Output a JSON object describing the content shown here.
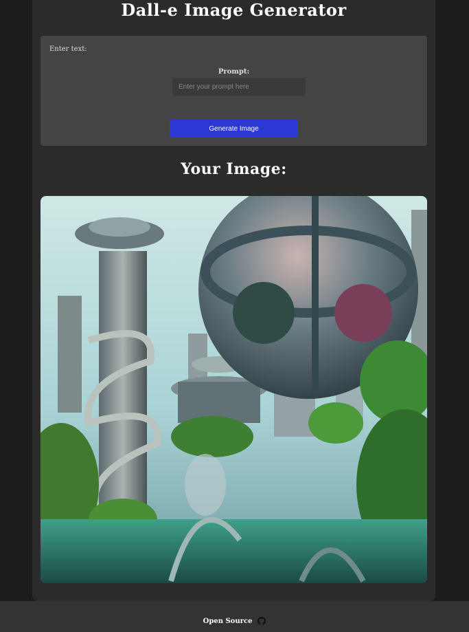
{
  "header": {
    "title": "Dall-e Image Generator"
  },
  "form": {
    "section_label": "Enter text:",
    "prompt_label": "Prompt:",
    "prompt_placeholder": "Enter your prompt here",
    "prompt_value": "",
    "generate_label": "Generate Image"
  },
  "result": {
    "title": "Your Image:"
  },
  "footer": {
    "link_label": "Open Source",
    "icon": "github-icon"
  },
  "colors": {
    "accent": "#2b38d4",
    "panel": "#444444",
    "card": "#2b2b2b",
    "background": "#1c1c1c"
  }
}
